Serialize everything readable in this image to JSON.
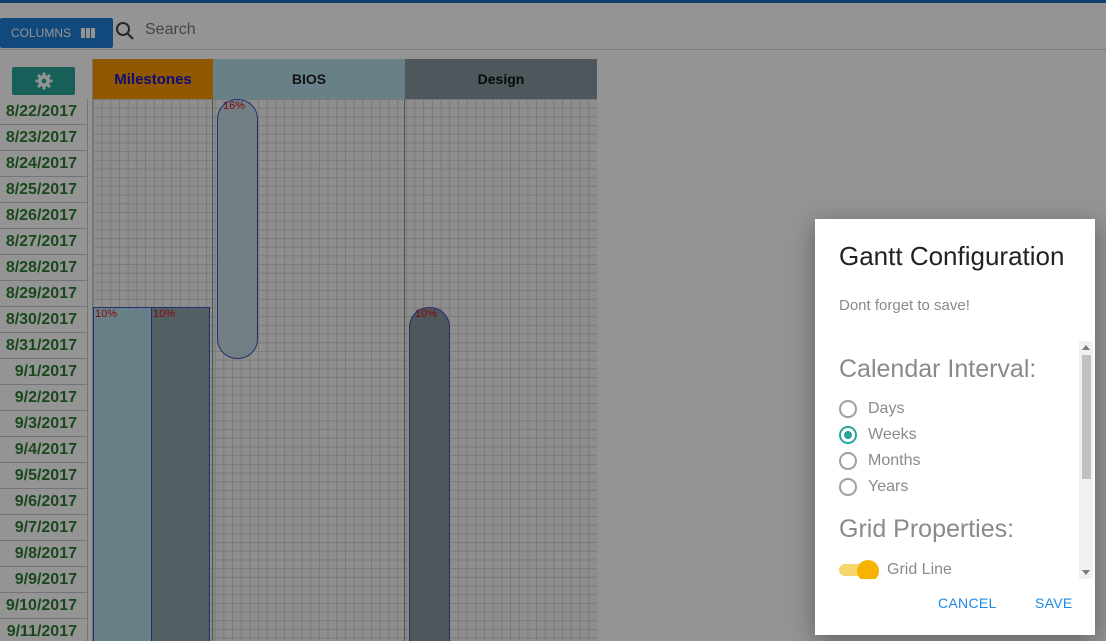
{
  "toolbar": {
    "columns_label": "COLUMNS",
    "search_placeholder": "Search"
  },
  "gantt": {
    "columns": [
      "Milestones",
      "BIOS",
      "Design"
    ],
    "dates": [
      "8/22/2017",
      "8/23/2017",
      "8/24/2017",
      "8/25/2017",
      "8/26/2017",
      "8/27/2017",
      "8/28/2017",
      "8/29/2017",
      "8/30/2017",
      "8/31/2017",
      "9/1/2017",
      "9/2/2017",
      "9/3/2017",
      "9/4/2017",
      "9/5/2017",
      "9/6/2017",
      "9/7/2017",
      "9/8/2017",
      "9/9/2017",
      "9/10/2017",
      "9/11/2017"
    ],
    "tasks": [
      {
        "percent": "10%"
      },
      {
        "percent": "10%"
      },
      {
        "percent": "16%"
      },
      {
        "percent": "10%"
      }
    ],
    "colors": {
      "milestones": "#fb9800",
      "bios": "#b3dcea",
      "design": "#85969f",
      "date_text": "#2e7d32"
    }
  },
  "modal": {
    "title": "Gantt Configuration",
    "subtitle": "Dont forget to save!",
    "calendar_heading": "Calendar Interval:",
    "intervals": [
      {
        "label": "Days",
        "checked": false
      },
      {
        "label": "Weeks",
        "checked": true
      },
      {
        "label": "Months",
        "checked": false
      },
      {
        "label": "Years",
        "checked": false
      }
    ],
    "grid_heading": "Grid Properties:",
    "grid_line_label": "Grid Line",
    "grid_line_on": true,
    "cancel_label": "CANCEL",
    "save_label": "SAVE"
  }
}
